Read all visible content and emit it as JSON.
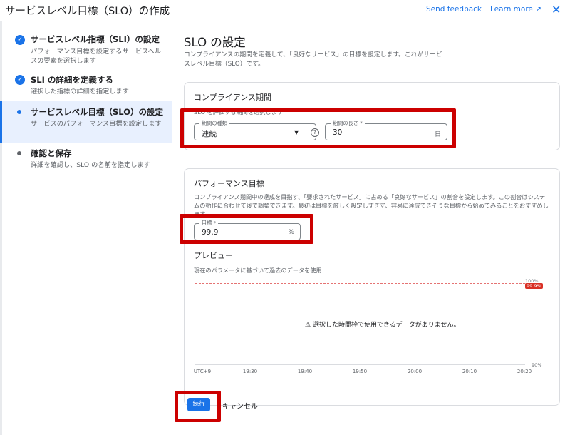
{
  "header": {
    "title": "サービスレベル目標（SLO）の作成",
    "feedback_label": "Send feedback",
    "learn_more_label": "Learn more",
    "learn_more_icon": "external-link-icon",
    "close_icon": "close-icon"
  },
  "sidebar": {
    "steps": [
      {
        "title": "サービスレベル指標（SLI）の設定",
        "desc": "パフォーマンス目標を設定するサービスヘルスの要素を選択します",
        "state": "done"
      },
      {
        "title": "SLI の詳細を定義する",
        "desc": "選択した指標の詳細を指定します",
        "state": "done"
      },
      {
        "title": "サービスレベル目標（SLO）の設定",
        "desc": "サービスのパフォーマンス目標を設定します",
        "state": "active"
      },
      {
        "title": "確認と保存",
        "desc": "詳細を確認し、SLO の名前を指定します",
        "state": "pending"
      }
    ]
  },
  "main": {
    "title": "SLO の設定",
    "intro": "コンプライアンスの期間を定義して、「良好なサービス」の目標を設定します。これがサービスレベル目標（SLO）です。",
    "compliance": {
      "title": "コンプライアンス期間",
      "subtitle": "SLO を評価する期間を選択します",
      "period_type_label": "期間の種類",
      "period_type_value": "連続",
      "period_length_label": "期間の長さ *",
      "period_length_value": "30",
      "period_length_unit": "日"
    },
    "performance": {
      "title": "パフォーマンス目標",
      "hint": "コンプライアンス期間中の達成を目指す、「要求されたサービス」に占める「良好なサービス」の割合を設定します。この割合はシステムの動作に合わせて後で調整できます。最初は目標を厳しく設定しすぎず、容易に達成できそうな目標から始めてみることをおすすめします。",
      "goal_label": "目標 *",
      "goal_value": "99.9",
      "goal_unit": "%"
    },
    "preview": {
      "title": "プレビュー",
      "subtitle": "現在のパラメータに基づいて過去のデータを使用",
      "y_top": "100%",
      "y_bottom": "90%",
      "target_badge": "99.9%",
      "no_data": "選択した時間枠で使用できるデータがありません。",
      "x_ticks": [
        "UTC+9",
        "19:30",
        "19:40",
        "19:50",
        "20:00",
        "20:10",
        "20:20"
      ]
    }
  },
  "actions": {
    "continue_label": "続行",
    "cancel_label": "キャンセル"
  },
  "colors": {
    "accent": "#1a73e8",
    "highlight_box": "#cc0000",
    "target_line": "#e57373"
  }
}
